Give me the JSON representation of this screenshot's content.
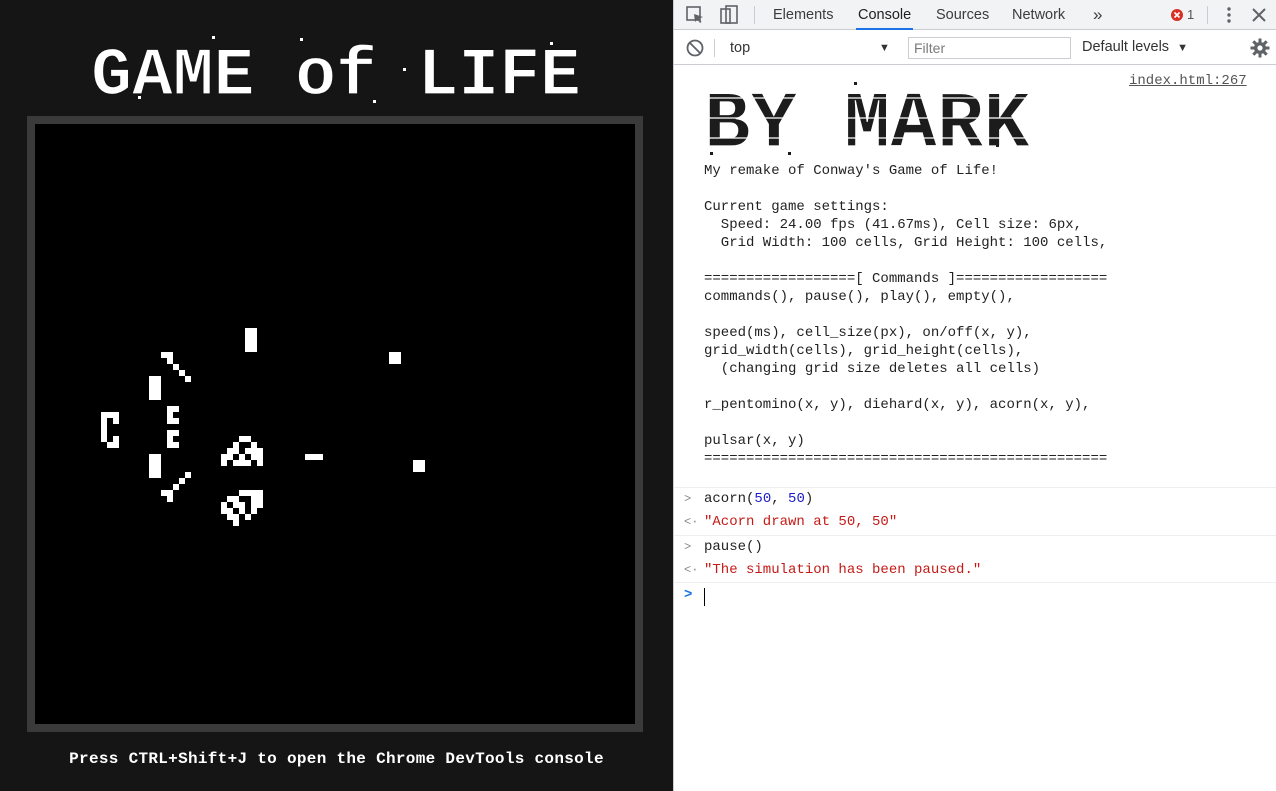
{
  "game": {
    "title": "GAME of LIFE",
    "hint": "Press CTRL+Shift+J to open the Chrome DevTools console"
  },
  "devtools": {
    "tabs": [
      "Elements",
      "Console",
      "Sources",
      "Network"
    ],
    "active_tab": "Console",
    "more_tabs": "»",
    "error_count": "1",
    "context": "top",
    "filter_placeholder": "Filter",
    "levels": "Default levels",
    "accent": "#1a73e8"
  },
  "console": {
    "source_link": "index.html:267",
    "logo_text": "BY MARK",
    "log_lines": [
      "My remake of Conway's Game of Life!",
      "",
      "Current game settings:",
      "  Speed: 24.00 fps (41.67ms), Cell size: 6px,",
      "  Grid Width: 100 cells, Grid Height: 100 cells,",
      "",
      "==================[ Commands ]==================",
      "commands(), pause(), play(), empty(),",
      "",
      "speed(ms), cell_size(px), on/off(x, y),",
      "grid_width(cells), grid_height(cells),",
      "  (changing grid size deletes all cells)",
      "",
      "r_pentomino(x, y), diehard(x, y), acorn(x, y),",
      "",
      "pulsar(x, y)",
      "================================================"
    ],
    "cmd1": {
      "fn": "acorn(",
      "a": "50",
      "sep": ", ",
      "b": "50",
      "end": ")"
    },
    "res1": "\"Acorn drawn at 50, 50\"",
    "cmd2": "pause()",
    "res2": "\"The simulation has been paused.\""
  }
}
